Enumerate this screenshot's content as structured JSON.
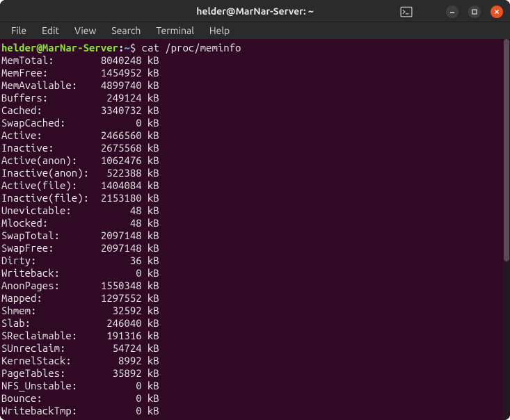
{
  "titlebar": {
    "title": "helder@MarNar-Server: ~"
  },
  "menubar": {
    "items": [
      "File",
      "Edit",
      "View",
      "Search",
      "Terminal",
      "Help"
    ]
  },
  "prompt": {
    "user_host": "helder@MarNar-Server",
    "sep": ":",
    "path": "~",
    "dollar": "$",
    "command": "cat /proc/meminfo"
  },
  "meminfo": [
    {
      "label": "MemTotal:",
      "value": "8040248",
      "unit": "kB"
    },
    {
      "label": "MemFree:",
      "value": "1454952",
      "unit": "kB"
    },
    {
      "label": "MemAvailable:",
      "value": "4899740",
      "unit": "kB"
    },
    {
      "label": "Buffers:",
      "value": "249124",
      "unit": "kB"
    },
    {
      "label": "Cached:",
      "value": "3340732",
      "unit": "kB"
    },
    {
      "label": "SwapCached:",
      "value": "0",
      "unit": "kB"
    },
    {
      "label": "Active:",
      "value": "2466560",
      "unit": "kB"
    },
    {
      "label": "Inactive:",
      "value": "2675568",
      "unit": "kB"
    },
    {
      "label": "Active(anon):",
      "value": "1062476",
      "unit": "kB"
    },
    {
      "label": "Inactive(anon):",
      "value": "522388",
      "unit": "kB"
    },
    {
      "label": "Active(file):",
      "value": "1404084",
      "unit": "kB"
    },
    {
      "label": "Inactive(file):",
      "value": "2153180",
      "unit": "kB"
    },
    {
      "label": "Unevictable:",
      "value": "48",
      "unit": "kB"
    },
    {
      "label": "Mlocked:",
      "value": "48",
      "unit": "kB"
    },
    {
      "label": "SwapTotal:",
      "value": "2097148",
      "unit": "kB"
    },
    {
      "label": "SwapFree:",
      "value": "2097148",
      "unit": "kB"
    },
    {
      "label": "Dirty:",
      "value": "36",
      "unit": "kB"
    },
    {
      "label": "Writeback:",
      "value": "0",
      "unit": "kB"
    },
    {
      "label": "AnonPages:",
      "value": "1550348",
      "unit": "kB"
    },
    {
      "label": "Mapped:",
      "value": "1297552",
      "unit": "kB"
    },
    {
      "label": "Shmem:",
      "value": "32592",
      "unit": "kB"
    },
    {
      "label": "Slab:",
      "value": "246040",
      "unit": "kB"
    },
    {
      "label": "SReclaimable:",
      "value": "191316",
      "unit": "kB"
    },
    {
      "label": "SUnreclaim:",
      "value": "54724",
      "unit": "kB"
    },
    {
      "label": "KernelStack:",
      "value": "8992",
      "unit": "kB"
    },
    {
      "label": "PageTables:",
      "value": "35892",
      "unit": "kB"
    },
    {
      "label": "NFS_Unstable:",
      "value": "0",
      "unit": "kB"
    },
    {
      "label": "Bounce:",
      "value": "0",
      "unit": "kB"
    },
    {
      "label": "WritebackTmp:",
      "value": "0",
      "unit": "kB"
    }
  ]
}
